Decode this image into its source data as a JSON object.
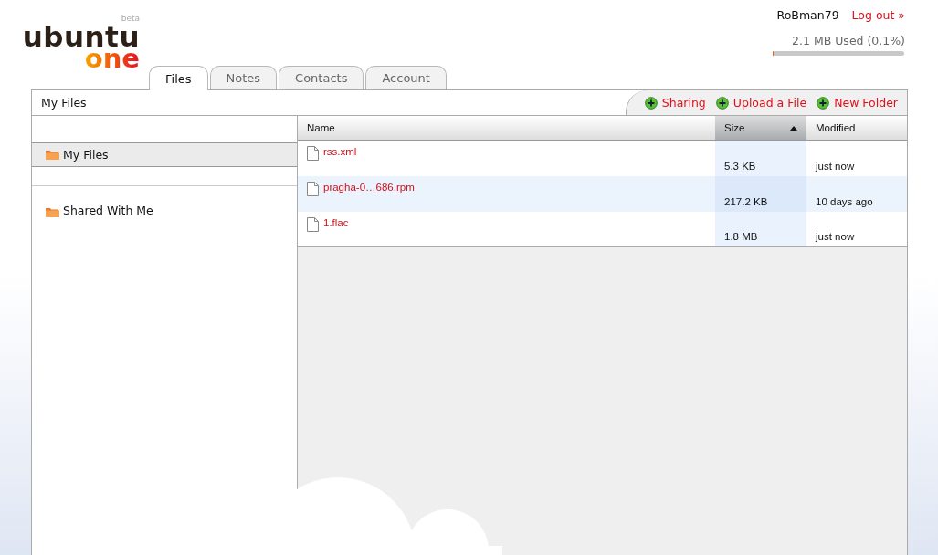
{
  "logo": {
    "word": "ubuntu",
    "sub": "one",
    "badge": "beta"
  },
  "user": {
    "name": "RoBman79",
    "logout": "Log out »"
  },
  "storage": {
    "text": "2.1 MB Used (0.1%)",
    "level": 0.001
  },
  "tabs": [
    {
      "label": "Files",
      "selected": true
    },
    {
      "label": "Notes",
      "selected": false
    },
    {
      "label": "Contacts",
      "selected": false
    },
    {
      "label": "Account",
      "selected": false
    }
  ],
  "panel": {
    "title": "My Files",
    "actions": [
      "Sharing",
      "Upload a File",
      "New Folder"
    ]
  },
  "sidebar": {
    "items": [
      {
        "label": "My Files",
        "selected": true
      },
      {
        "label": "Shared With Me",
        "selected": false
      }
    ]
  },
  "table": {
    "columns": [
      {
        "label": "Name",
        "sorted": false
      },
      {
        "label": "Size",
        "sorted": true
      },
      {
        "label": "Modified",
        "sorted": false
      }
    ],
    "rows": [
      {
        "name": "rss.xml",
        "size": "5.3 KB",
        "modified": "just now",
        "selected": false
      },
      {
        "name": "pragha-0…686.rpm",
        "size": "217.2 KB",
        "modified": "10 days ago",
        "selected": true
      },
      {
        "name": "1.flac",
        "size": "1.8 MB",
        "modified": "just now",
        "selected": false
      }
    ]
  }
}
